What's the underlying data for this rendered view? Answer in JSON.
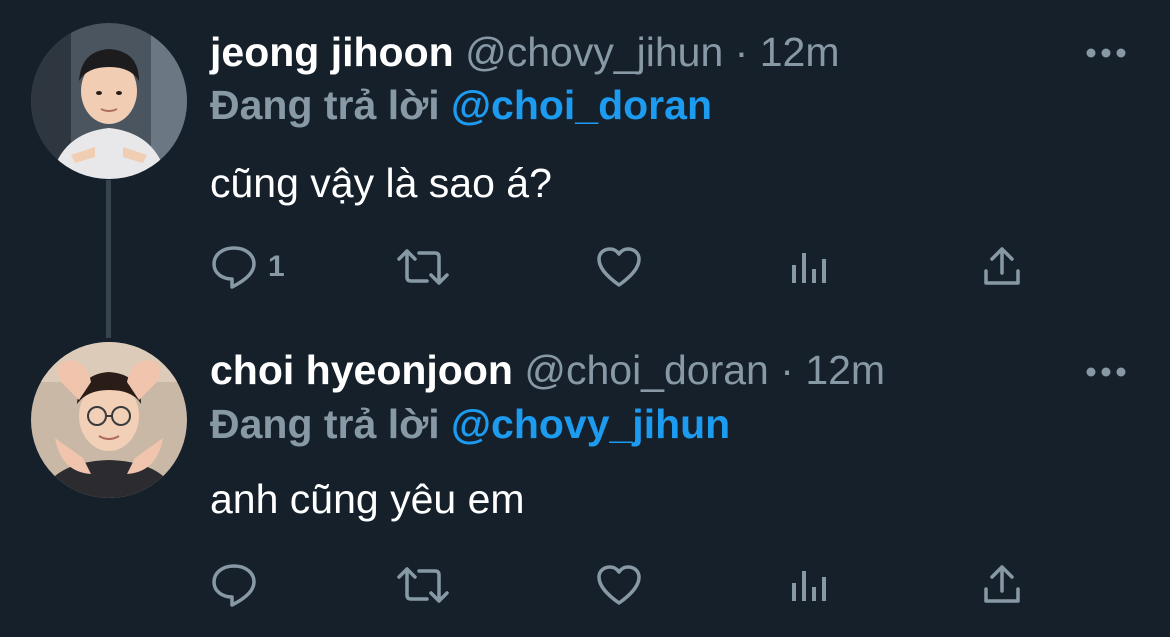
{
  "colors": {
    "background": "#15202b",
    "secondary_text": "#8899a6",
    "mention": "#1d9bf0",
    "thread_line": "#38444d"
  },
  "tweets": [
    {
      "name": "jeong jihoon",
      "handle": "@chovy_jihun",
      "separator": "·",
      "time": "12m",
      "reply_label": "Đang trả lời",
      "reply_to": "@choi_doran",
      "text": "cũng vậy là sao á?",
      "reply_count": "1",
      "icons": [
        "reply-icon",
        "retweet-icon",
        "like-icon",
        "stats-icon",
        "share-icon",
        "more-icon"
      ]
    },
    {
      "name": "choi hyeonjoon",
      "handle": "@choi_doran",
      "separator": "·",
      "time": "12m",
      "reply_label": "Đang trả lời",
      "reply_to": "@chovy_jihun",
      "text": "anh cũng yêu em",
      "reply_count": "",
      "icons": [
        "reply-icon",
        "retweet-icon",
        "like-icon",
        "stats-icon",
        "share-icon",
        "more-icon"
      ]
    }
  ]
}
